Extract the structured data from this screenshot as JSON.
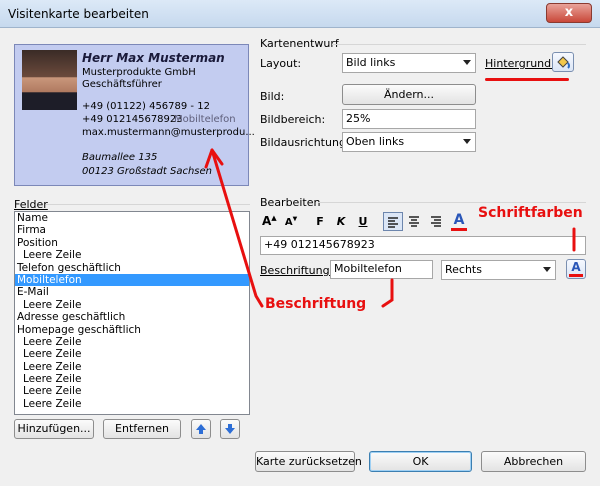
{
  "window": {
    "title": "Visitenkarte bearbeiten",
    "close_glyph": "x"
  },
  "card": {
    "name": "Herr Max Musterman",
    "company": "Musterprodukte GmbH",
    "position": "Geschäftsführer",
    "phone_work": "+49 (01122) 456789 - 12",
    "phone_mobile": "+49 012145678923",
    "phone_mobile_label": "Mobiltelefon",
    "email": "max.mustermann@musterprodu...",
    "street": "Baumallee 135",
    "city": "00123 Großstadt Sachsen",
    "background_color": "#c3ccf0"
  },
  "design": {
    "section_label": "Kartenentwurf",
    "layout_label": "Layout:",
    "layout_value": "Bild links",
    "background_label": "Hintergrund:",
    "image_label": "Bild:",
    "image_button": "Ändern...",
    "image_area_label": "Bildbereich:",
    "image_area_value": "25%",
    "image_align_label": "Bildausrichtung:",
    "image_align_value": "Oben links"
  },
  "fields": {
    "label": "Felder",
    "items": [
      {
        "label": "Name",
        "indent": false,
        "selected": false
      },
      {
        "label": "Firma",
        "indent": false,
        "selected": false
      },
      {
        "label": "Position",
        "indent": false,
        "selected": false
      },
      {
        "label": "Leere Zeile",
        "indent": true,
        "selected": false
      },
      {
        "label": "Telefon geschäftlich",
        "indent": false,
        "selected": false
      },
      {
        "label": "Mobiltelefon",
        "indent": false,
        "selected": true
      },
      {
        "label": "E-Mail",
        "indent": false,
        "selected": false
      },
      {
        "label": "Leere Zeile",
        "indent": true,
        "selected": false
      },
      {
        "label": "Adresse geschäftlich",
        "indent": false,
        "selected": false
      },
      {
        "label": "Homepage geschäftlich",
        "indent": false,
        "selected": false
      },
      {
        "label": "Leere Zeile",
        "indent": true,
        "selected": false
      },
      {
        "label": "Leere Zeile",
        "indent": true,
        "selected": false
      },
      {
        "label": "Leere Zeile",
        "indent": true,
        "selected": false
      },
      {
        "label": "Leere Zeile",
        "indent": true,
        "selected": false
      },
      {
        "label": "Leere Zeile",
        "indent": true,
        "selected": false
      },
      {
        "label": "Leere Zeile",
        "indent": true,
        "selected": false
      }
    ],
    "add_button": "Hinzufügen...",
    "remove_button": "Entfernen"
  },
  "edit": {
    "section_label": "Bearbeiten",
    "text_value": "+49 012145678923",
    "caption_label": "Beschriftung:",
    "caption_value": "Mobiltelefon",
    "align_value": "Rechts"
  },
  "footer": {
    "reset_button": "Karte zurücksetzen",
    "ok_button": "OK",
    "cancel_button": "Abbrechen"
  },
  "annotations": {
    "font_colors": "Schriftfarben",
    "caption": "Beschriftung",
    "color": "#e81010"
  }
}
